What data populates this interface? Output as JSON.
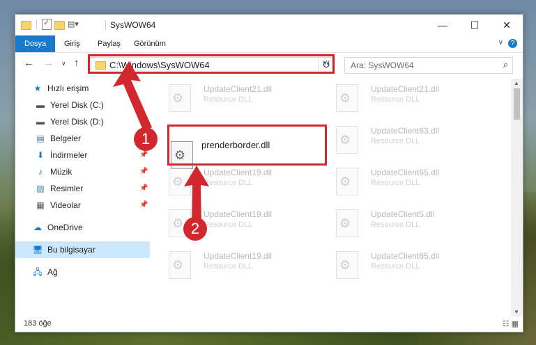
{
  "window": {
    "title": "SysWOW64",
    "controls": {
      "minimize": "—",
      "maximize": "☐",
      "close": "✕"
    }
  },
  "ribbon": {
    "tabs": [
      "Dosya",
      "Giriş",
      "Paylaş",
      "Görünüm"
    ],
    "help": "?",
    "accent": "#1979ca"
  },
  "address": {
    "path": "C:\\Windows\\SysWOW64",
    "search_placeholder": "Ara: SysWOW64"
  },
  "nav_pane": {
    "items": [
      {
        "label": "Hızlı erişim",
        "icon": "star-icon",
        "pinned": false
      },
      {
        "label": "Yerel Disk (C:)",
        "icon": "drive-icon",
        "pinned": true
      },
      {
        "label": "Yerel Disk (D:)",
        "icon": "drive-icon",
        "pinned": true
      },
      {
        "label": "Belgeler",
        "icon": "document-icon",
        "pinned": true
      },
      {
        "label": "İndirmeler",
        "icon": "download-icon",
        "pinned": true
      },
      {
        "label": "Müzik",
        "icon": "music-icon",
        "pinned": true
      },
      {
        "label": "Resimler",
        "icon": "picture-icon",
        "pinned": true
      },
      {
        "label": "Videolar",
        "icon": "video-icon",
        "pinned": true
      },
      {
        "label": "OneDrive",
        "icon": "cloud-icon",
        "pinned": false
      },
      {
        "label": "Bu bilgisayar",
        "icon": "computer-icon",
        "pinned": false
      },
      {
        "label": "Ağ",
        "icon": "network-icon",
        "pinned": false
      }
    ]
  },
  "files": {
    "selected": {
      "name": "prenderborder.dll"
    },
    "faded": [
      {
        "name": "UpdateClient21.dll",
        "type": "Resource DLL"
      },
      {
        "name": "UpdateClient21.dll",
        "type": "Resource DLL"
      },
      {
        "name": "UpdateClient63.dll",
        "type": "Resource DLL"
      },
      {
        "name": "UpdateClient19.dll",
        "type": "Resource DLL"
      },
      {
        "name": "UpdateClient65.dll",
        "type": "Resource DLL"
      },
      {
        "name": "UpdateClient19.dll",
        "type": "Resource DLL"
      },
      {
        "name": "UpdateClient5.dll",
        "type": "Resource DLL"
      },
      {
        "name": "UpdateClient19.dll",
        "type": "Resource DLL"
      },
      {
        "name": "UpdateClient65.dll",
        "type": "Resource DLL"
      }
    ]
  },
  "status": {
    "count": "183 öğe"
  },
  "annotations": {
    "step1": "1",
    "step2": "2",
    "color": "#d0282e"
  }
}
